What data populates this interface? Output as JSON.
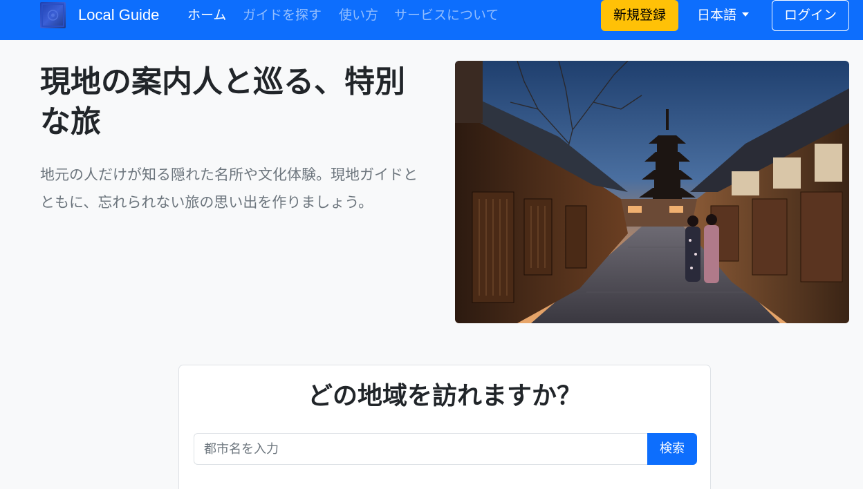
{
  "navbar": {
    "brand": "Local Guide",
    "links": [
      {
        "label": "ホーム",
        "active": true
      },
      {
        "label": "ガイドを探す",
        "active": false
      },
      {
        "label": "使い方",
        "active": false
      },
      {
        "label": "サービスについて",
        "active": false
      }
    ],
    "signup_label": "新規登録",
    "language": "日本語",
    "login_label": "ログイン"
  },
  "hero": {
    "title": "現地の案内人と巡る、特別な旅",
    "lead": "地元の人だけが知る隠れた名所や文化体験。現地ガイドとともに、忘れられない旅の思い出を作りましょう。",
    "image_icon": "kyoto-street-photo"
  },
  "search": {
    "heading": "どの地域を訪れますか？",
    "placeholder": "都市名を入力",
    "value": "",
    "button_label": "検索"
  },
  "colors": {
    "primary": "#0d6efd",
    "warning": "#ffc107",
    "background": "#f8f9fa"
  }
}
